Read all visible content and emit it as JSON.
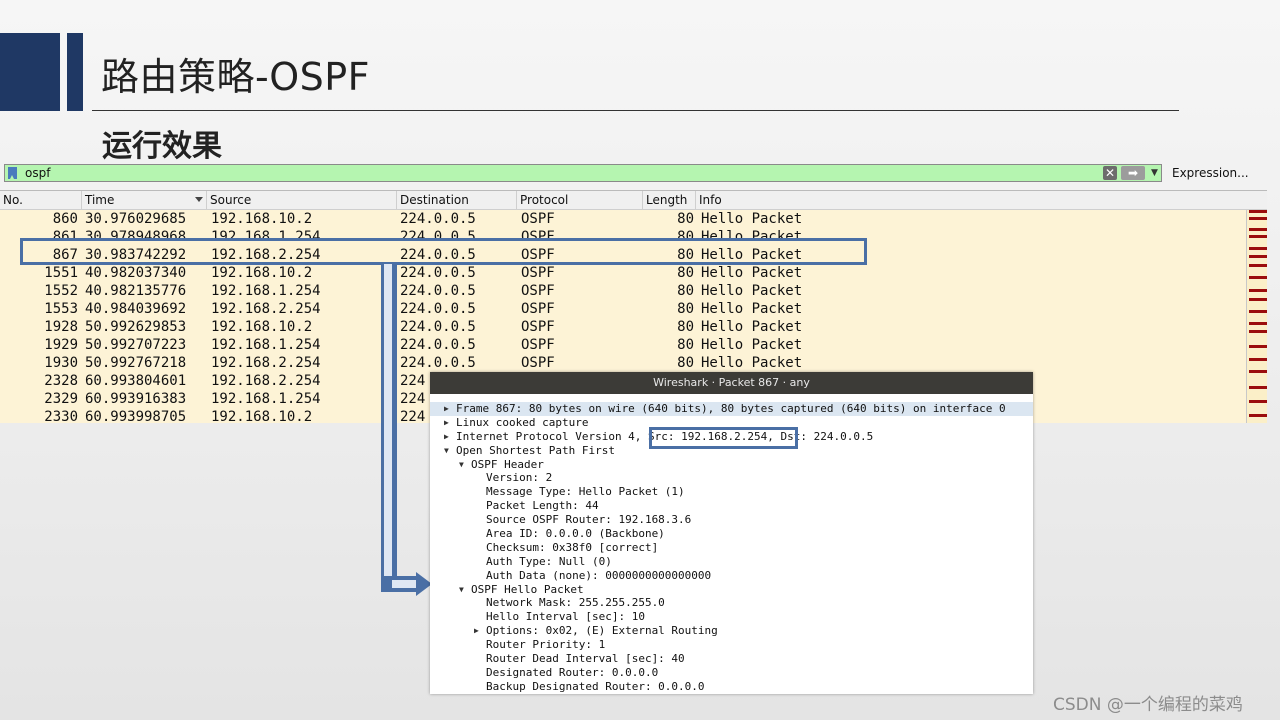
{
  "slide": {
    "title": "路由策略-OSPF",
    "subtitle": "运行效果",
    "watermark": "CSDN @一个编程的菜鸡",
    "colors": {
      "accent": "#1f3864",
      "callout": "#4a6fa5",
      "filter_bg": "#b5f5b0",
      "row_bg": "#fdf3d6"
    }
  },
  "filter": {
    "value": "ospf",
    "expression_label": "Expression..."
  },
  "packet_list": {
    "columns": [
      "No.",
      "Time",
      "Source",
      "Destination",
      "Protocol",
      "Length",
      "Info"
    ],
    "rows": [
      {
        "no": "860",
        "time": "30.976029685",
        "src": "192.168.10.2",
        "dst": "224.0.0.5",
        "proto": "OSPF",
        "len": "80",
        "info": "Hello Packet"
      },
      {
        "no": "861",
        "time": "30.978948968",
        "src": "192.168.1.254",
        "dst": "224.0.0.5",
        "proto": "OSPF",
        "len": "80",
        "info": "Hello Packet"
      },
      {
        "no": "867",
        "time": "30.983742292",
        "src": "192.168.2.254",
        "dst": "224.0.0.5",
        "proto": "OSPF",
        "len": "80",
        "info": "Hello Packet"
      },
      {
        "no": "1551",
        "time": "40.982037340",
        "src": "192.168.10.2",
        "dst": "224.0.0.5",
        "proto": "OSPF",
        "len": "80",
        "info": "Hello Packet"
      },
      {
        "no": "1552",
        "time": "40.982135776",
        "src": "192.168.1.254",
        "dst": "224.0.0.5",
        "proto": "OSPF",
        "len": "80",
        "info": "Hello Packet"
      },
      {
        "no": "1553",
        "time": "40.984039692",
        "src": "192.168.2.254",
        "dst": "224.0.0.5",
        "proto": "OSPF",
        "len": "80",
        "info": "Hello Packet"
      },
      {
        "no": "1928",
        "time": "50.992629853",
        "src": "192.168.10.2",
        "dst": "224.0.0.5",
        "proto": "OSPF",
        "len": "80",
        "info": "Hello Packet"
      },
      {
        "no": "1929",
        "time": "50.992707223",
        "src": "192.168.1.254",
        "dst": "224.0.0.5",
        "proto": "OSPF",
        "len": "80",
        "info": "Hello Packet"
      },
      {
        "no": "1930",
        "time": "50.992767218",
        "src": "192.168.2.254",
        "dst": "224.0.0.5",
        "proto": "OSPF",
        "len": "80",
        "info": "Hello Packet"
      },
      {
        "no": "2328",
        "time": "60.993804601",
        "src": "192.168.2.254",
        "dst": "224",
        "proto": "",
        "len": "",
        "info": ""
      },
      {
        "no": "2329",
        "time": "60.993916383",
        "src": "192.168.1.254",
        "dst": "224",
        "proto": "",
        "len": "",
        "info": ""
      },
      {
        "no": "2330",
        "time": "60.993998705",
        "src": "192.168.10.2",
        "dst": "224",
        "proto": "",
        "len": "",
        "info": ""
      }
    ]
  },
  "packet_window": {
    "title": "Wireshark · Packet 867 · any",
    "tree": [
      {
        "text": "Frame 867: 80 bytes on wire (640 bits), 80 bytes captured (640 bits) on interface 0",
        "level": 0,
        "toggle": "collapsed"
      },
      {
        "text": "Linux cooked capture",
        "level": 0,
        "toggle": "collapsed"
      },
      {
        "text": "Internet Protocol Version 4, Src: 192.168.2.254, Dst: 224.0.0.5",
        "level": 0,
        "toggle": "collapsed"
      },
      {
        "text": "Open Shortest Path First",
        "level": 0,
        "toggle": "expanded"
      },
      {
        "text": "OSPF Header",
        "level": 1,
        "toggle": "expanded"
      },
      {
        "text": "Version: 2",
        "level": 2,
        "toggle": "none"
      },
      {
        "text": "Message Type: Hello Packet (1)",
        "level": 2,
        "toggle": "none"
      },
      {
        "text": "Packet Length: 44",
        "level": 2,
        "toggle": "none"
      },
      {
        "text": "Source OSPF Router: 192.168.3.6",
        "level": 2,
        "toggle": "none"
      },
      {
        "text": "Area ID: 0.0.0.0 (Backbone)",
        "level": 2,
        "toggle": "none"
      },
      {
        "text": "Checksum: 0x38f0 [correct]",
        "level": 2,
        "toggle": "none"
      },
      {
        "text": "Auth Type: Null (0)",
        "level": 2,
        "toggle": "none"
      },
      {
        "text": "Auth Data (none): 0000000000000000",
        "level": 2,
        "toggle": "none"
      },
      {
        "text": "OSPF Hello Packet",
        "level": 1,
        "toggle": "expanded"
      },
      {
        "text": "Network Mask: 255.255.255.0",
        "level": 2,
        "toggle": "none"
      },
      {
        "text": "Hello Interval [sec]: 10",
        "level": 2,
        "toggle": "none"
      },
      {
        "text": "Options: 0x02, (E) External Routing",
        "level": 2,
        "toggle": "collapsed"
      },
      {
        "text": "Router Priority: 1",
        "level": 2,
        "toggle": "none"
      },
      {
        "text": "Router Dead Interval [sec]: 40",
        "level": 2,
        "toggle": "none"
      },
      {
        "text": "Designated Router: 0.0.0.0",
        "level": 2,
        "toggle": "none"
      },
      {
        "text": "Backup Designated Router: 0.0.0.0",
        "level": 2,
        "toggle": "none"
      }
    ]
  }
}
